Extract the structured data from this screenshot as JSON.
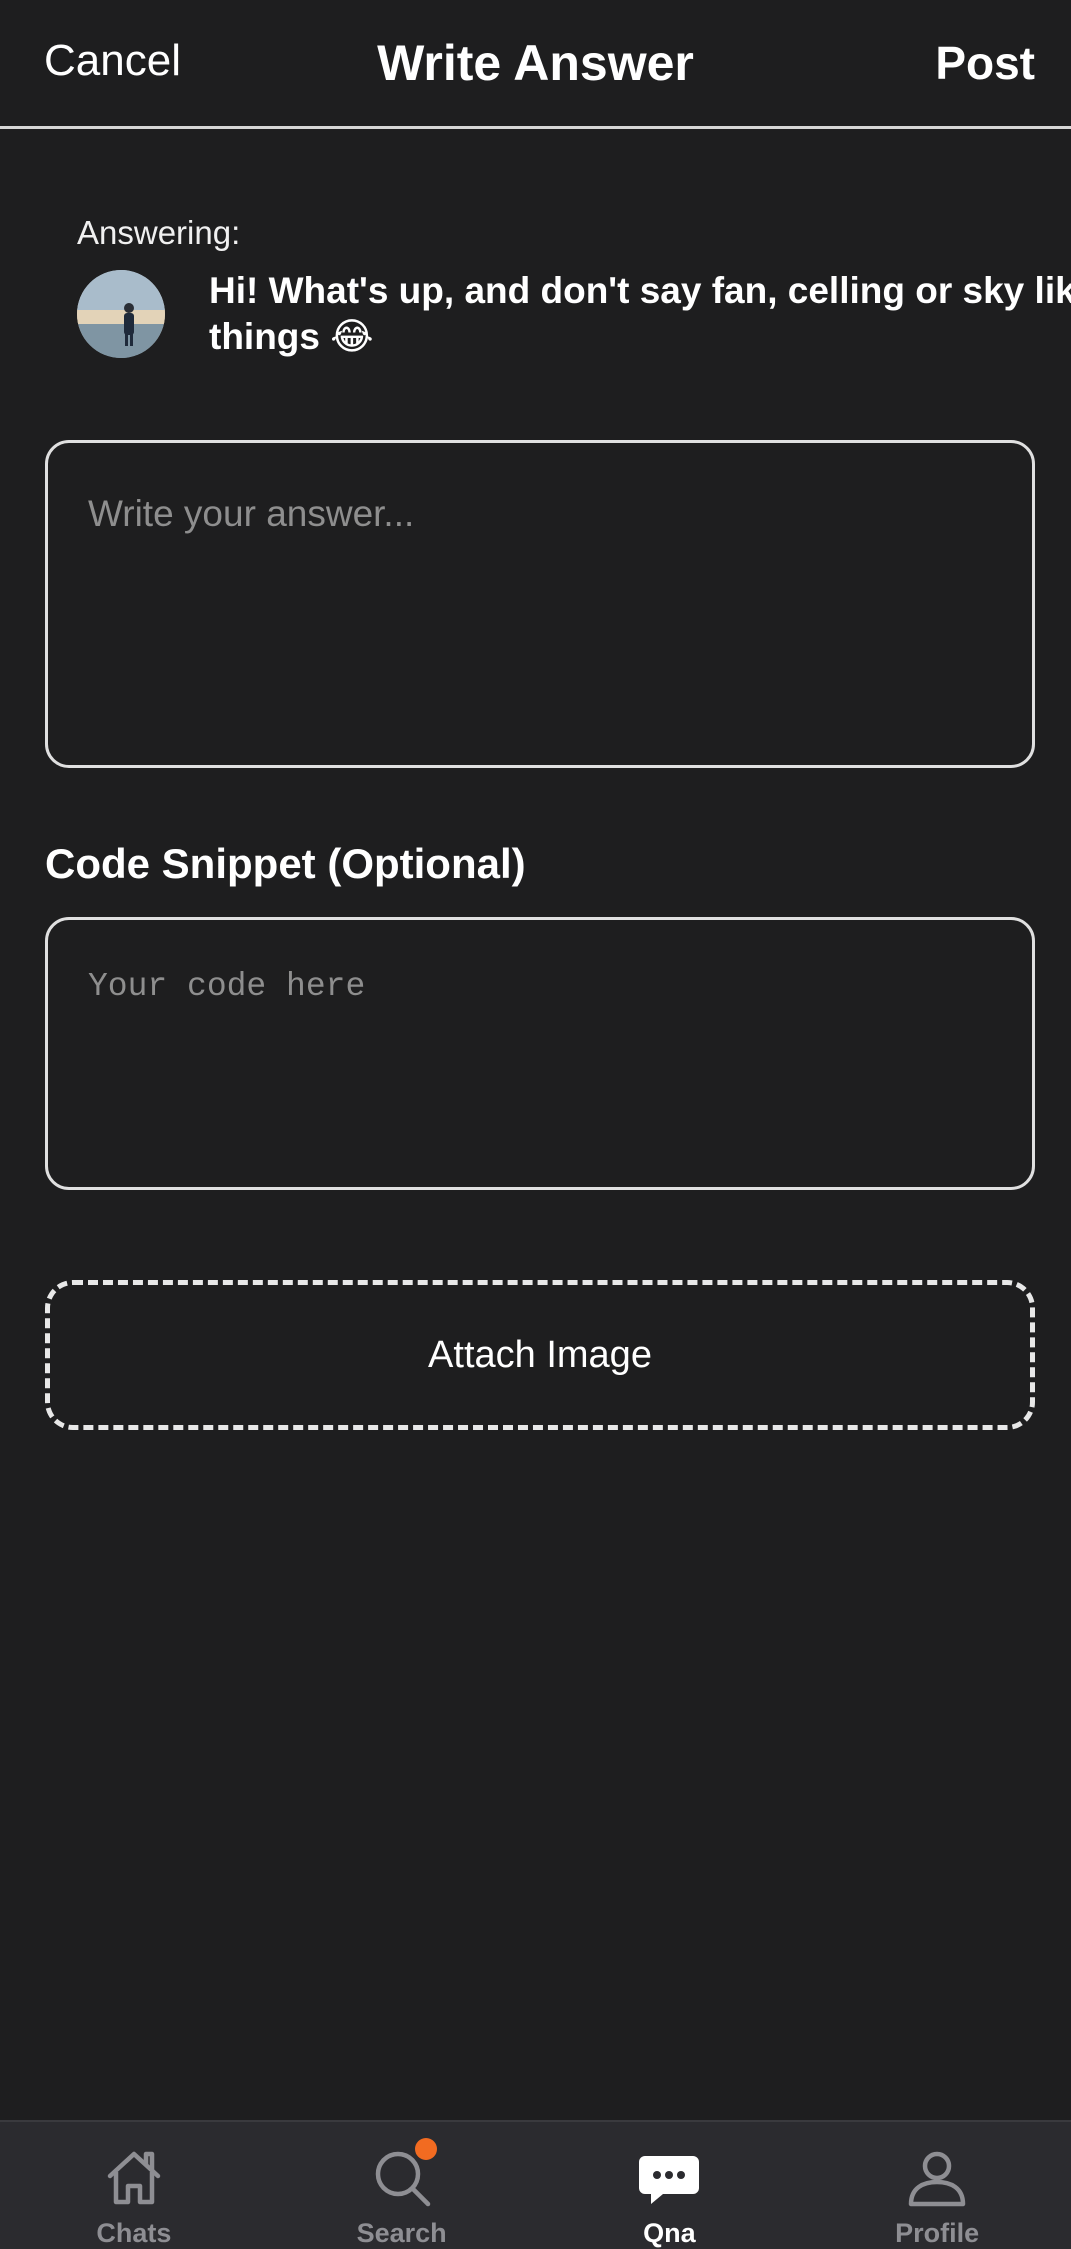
{
  "header": {
    "cancel_label": "Cancel",
    "title": "Write Answer",
    "post_label": "Post"
  },
  "question": {
    "answering_label": "Answering:",
    "text": "Hi! What's up, and don't say fan, celling or sky like\nthings 😂",
    "avatar_icon": "user-photo"
  },
  "answer": {
    "placeholder": "Write your answer...",
    "value": ""
  },
  "code_snippet": {
    "label": "Code Snippet (Optional)",
    "placeholder": "Your code here",
    "value": ""
  },
  "attach": {
    "label": "Attach Image"
  },
  "tabbar": {
    "items": [
      {
        "label": "Chats",
        "icon": "home-icon",
        "active": false
      },
      {
        "label": "Search",
        "icon": "search-icon",
        "active": false,
        "notification": true
      },
      {
        "label": "Qna",
        "icon": "chat-bubble-icon",
        "active": true
      },
      {
        "label": "Profile",
        "icon": "person-icon",
        "active": false
      }
    ]
  },
  "colors": {
    "background": "#1e1e1f",
    "tabbar": "#2b2b2f",
    "notification": "#f26b21",
    "inactive_tab": "#8e8e93"
  }
}
